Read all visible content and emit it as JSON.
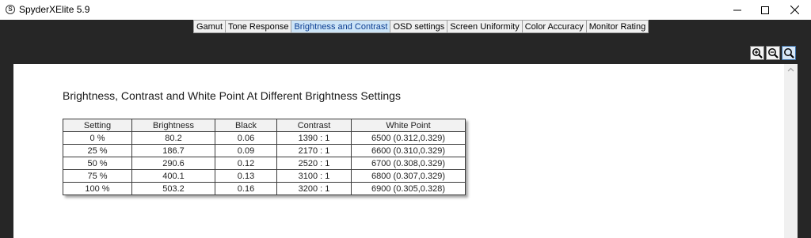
{
  "app": {
    "title": "SpyderXElite 5.9",
    "icon_glyph": "S"
  },
  "window_controls": {
    "minimize_icon": "minimize-icon",
    "maximize_icon": "maximize-icon",
    "close_icon": "close-icon"
  },
  "tabs": [
    {
      "label": "Gamut",
      "active": false
    },
    {
      "label": "Tone Response",
      "active": false
    },
    {
      "label": "Brightness and Contrast",
      "active": true
    },
    {
      "label": "OSD settings",
      "active": false
    },
    {
      "label": "Screen Uniformity",
      "active": false
    },
    {
      "label": "Color Accuracy",
      "active": false
    },
    {
      "label": "Monitor Rating",
      "active": false
    }
  ],
  "zoom": {
    "zoom_in_icon": "zoom-in-icon",
    "zoom_out_icon": "zoom-out-icon",
    "zoom_fit_icon": "zoom-fit-icon",
    "fit_pressed": true
  },
  "report": {
    "title": "Brightness, Contrast and White Point At Different Brightness Settings",
    "columns": [
      "Setting",
      "Brightness",
      "Black",
      "Contrast",
      "White Point"
    ],
    "rows": [
      [
        "0 %",
        "80.2",
        "0.06",
        "1390 : 1",
        "6500 (0.312,0.329)"
      ],
      [
        "25 %",
        "186.7",
        "0.09",
        "2170 : 1",
        "6600 (0.310,0.329)"
      ],
      [
        "50 %",
        "290.6",
        "0.12",
        "2520 : 1",
        "6700 (0.308,0.329)"
      ],
      [
        "75 %",
        "400.1",
        "0.13",
        "3100 : 1",
        "6800 (0.307,0.329)"
      ],
      [
        "100 %",
        "503.2",
        "0.16",
        "3200 : 1",
        "6900 (0.305,0.328)"
      ]
    ]
  },
  "colors": {
    "dark_band": "#262626",
    "active_tab": "#cce4f7",
    "tab": "#f0f0f0"
  }
}
